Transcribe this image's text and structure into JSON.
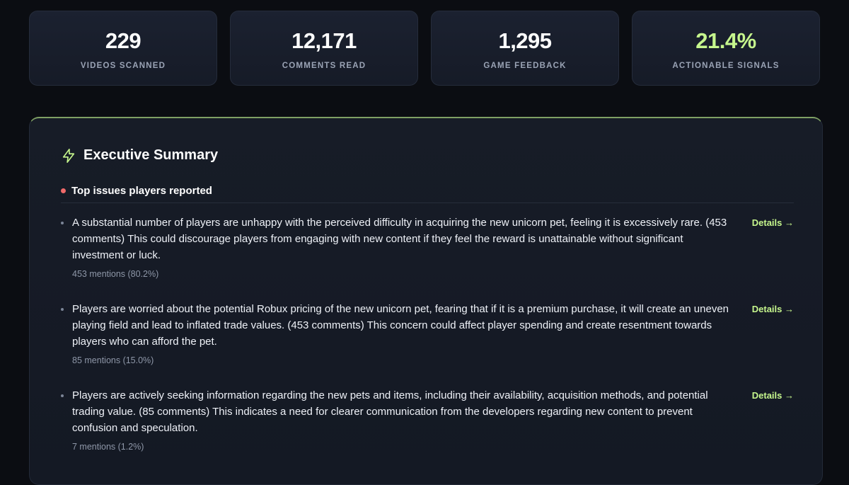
{
  "stats": [
    {
      "value": "229",
      "label": "VIDEOS SCANNED"
    },
    {
      "value": "12,171",
      "label": "COMMENTS READ"
    },
    {
      "value": "1,295",
      "label": "GAME FEEDBACK"
    },
    {
      "value": "21.4%",
      "label": "ACTIONABLE SIGNALS"
    }
  ],
  "summary": {
    "title": "Executive Summary",
    "section_title": "Top issues players reported",
    "issues": [
      {
        "text": "A substantial number of players are unhappy with the perceived difficulty in acquiring the new unicorn pet, feeling it is excessively rare. (453 comments) This could discourage players from engaging with new content if they feel the reward is unattainable without significant investment or luck.",
        "mentions": "453 mentions (80.2%)",
        "details_label": "Details →"
      },
      {
        "text": "Players are worried about the potential Robux pricing of the new unicorn pet, fearing that if it is a premium purchase, it will create an uneven playing field and lead to inflated trade values. (453 comments) This concern could affect player spending and create resentment towards players who can afford the pet.",
        "mentions": "85 mentions (15.0%)",
        "details_label": "Details →"
      },
      {
        "text": "Players are actively seeking information regarding the new pets and items, including their availability, acquisition methods, and potential trading value. (85 comments) This indicates a need for clearer communication from the developers regarding new content to prevent confusion and speculation.",
        "mentions": "7 mentions (1.2%)",
        "details_label": "Details →"
      }
    ]
  },
  "colors": {
    "accent": "#c6f68d",
    "background": "#0b0d12",
    "card": "#1b2130",
    "issue_dot": "#f06a6a"
  }
}
